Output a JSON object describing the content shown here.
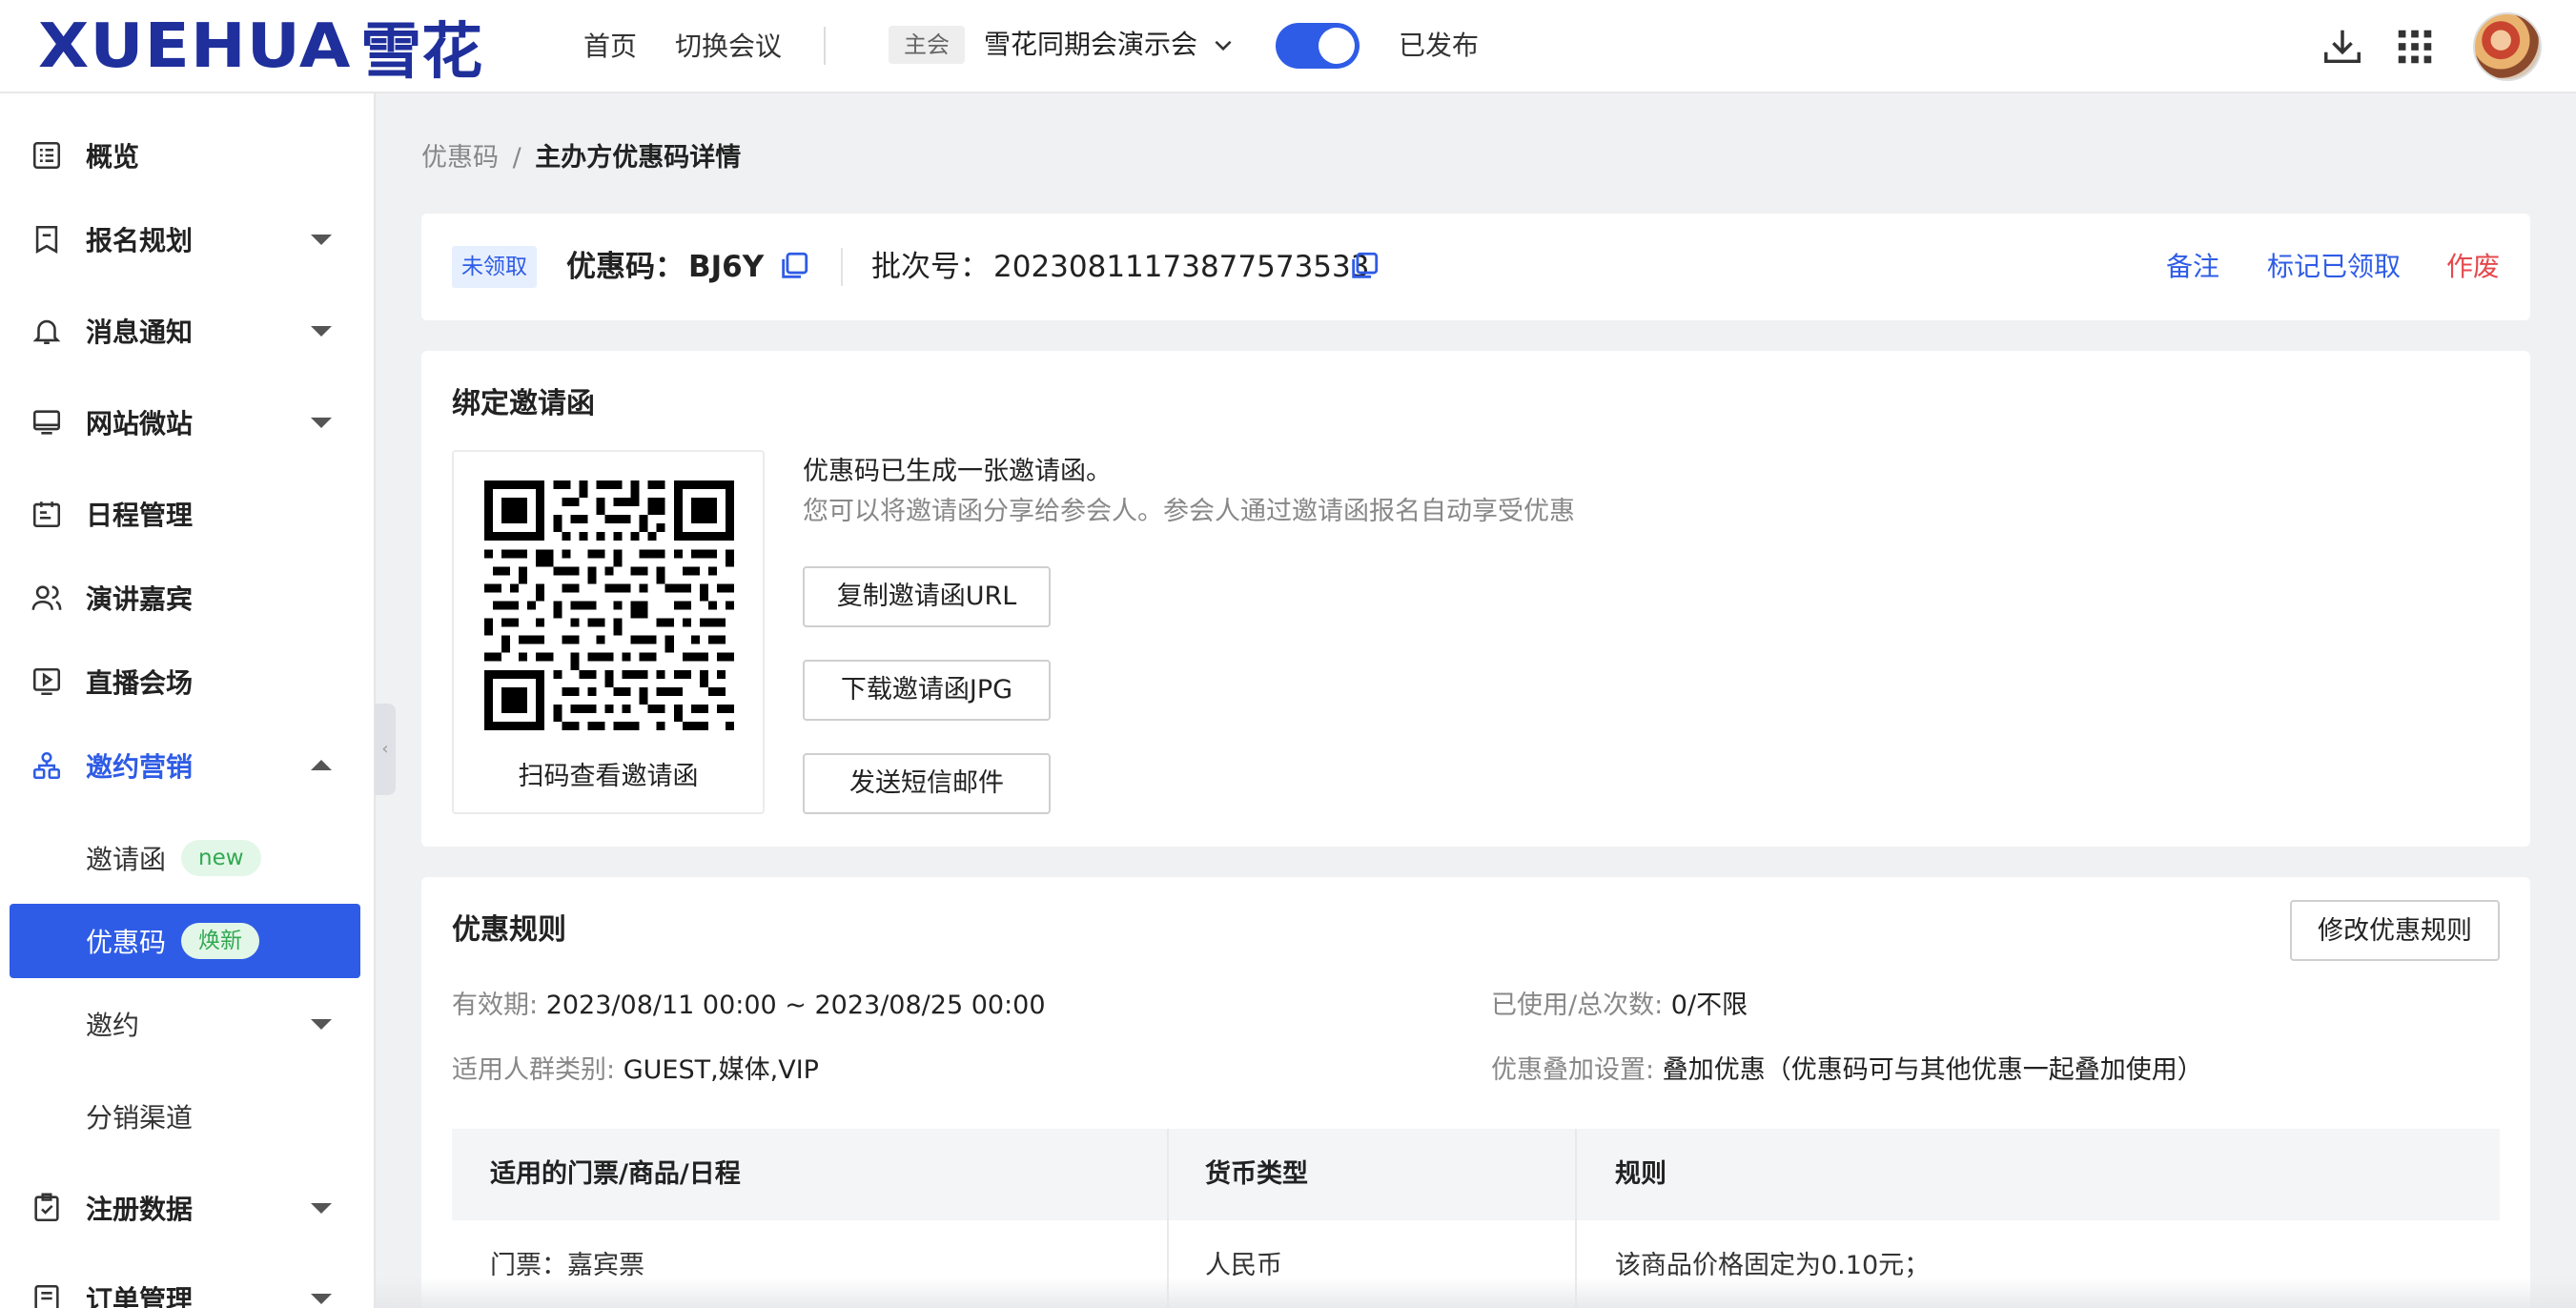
{
  "header": {
    "logo_en": "XUEHUA",
    "logo_cn": "雪花",
    "nav": [
      "首页",
      "切换会议"
    ],
    "host_tag": "主会",
    "meeting_name": "雪花同期会演示会",
    "publish_toggle": true,
    "publish_label": "已发布"
  },
  "sidebar": {
    "items": [
      {
        "label": "概览"
      },
      {
        "label": "报名规划"
      },
      {
        "label": "消息通知"
      },
      {
        "label": "网站微站"
      },
      {
        "label": "日程管理"
      },
      {
        "label": "演讲嘉宾"
      },
      {
        "label": "直播会场"
      },
      {
        "label": "邀约营销"
      },
      {
        "label": "注册数据"
      },
      {
        "label": "订单管理"
      }
    ],
    "sub_items": [
      {
        "label": "邀请函",
        "badge": "new"
      },
      {
        "label": "优惠码",
        "badge": "焕新"
      },
      {
        "label": "邀约"
      },
      {
        "label": "分销渠道"
      }
    ]
  },
  "breadcrumb": {
    "parent": "优惠码",
    "sep": "/",
    "current": "主办方优惠码详情"
  },
  "code_card": {
    "status": "未领取",
    "code_label": "优惠码：",
    "code_value": "BJ6Y",
    "batch_label": "批次号：",
    "batch_value": "20230811173877573533",
    "actions": [
      "备注",
      "标记已领取",
      "作废"
    ]
  },
  "invite_card": {
    "title": "绑定邀请函",
    "qr_caption": "扫码查看邀请函",
    "line1": "优惠码已生成一张邀请函。",
    "line2": "您可以将邀请函分享给参会人。参会人通过邀请函报名自动享受优惠",
    "buttons": [
      "复制邀请函URL",
      "下载邀请函JPG",
      "发送短信邮件"
    ]
  },
  "rule_card": {
    "title": "优惠规则",
    "edit_button": "修改优惠规则",
    "validity_label": "有效期:",
    "validity_value": "2023/08/11 00:00 ~ 2023/08/25 00:00",
    "usage_label": "已使用/总次数:",
    "usage_value": "0/不限",
    "audience_label": "适用人群类别:",
    "audience_value": "GUEST,媒体,VIP",
    "stack_label": "优惠叠加设置:",
    "stack_value": "叠加优惠（优惠码可与其他优惠一起叠加使用）",
    "table": {
      "headers": [
        "适用的门票/商品/日程",
        "货币类型",
        "规则"
      ],
      "rows": [
        [
          "门票：嘉宾票",
          "人民币",
          "该商品价格固定为0.10元；"
        ]
      ]
    }
  },
  "colors": {
    "accent": "#2f5ce6",
    "danger": "#e5484d",
    "logo": "#1f2f9c",
    "badge_green": "#32a852"
  }
}
